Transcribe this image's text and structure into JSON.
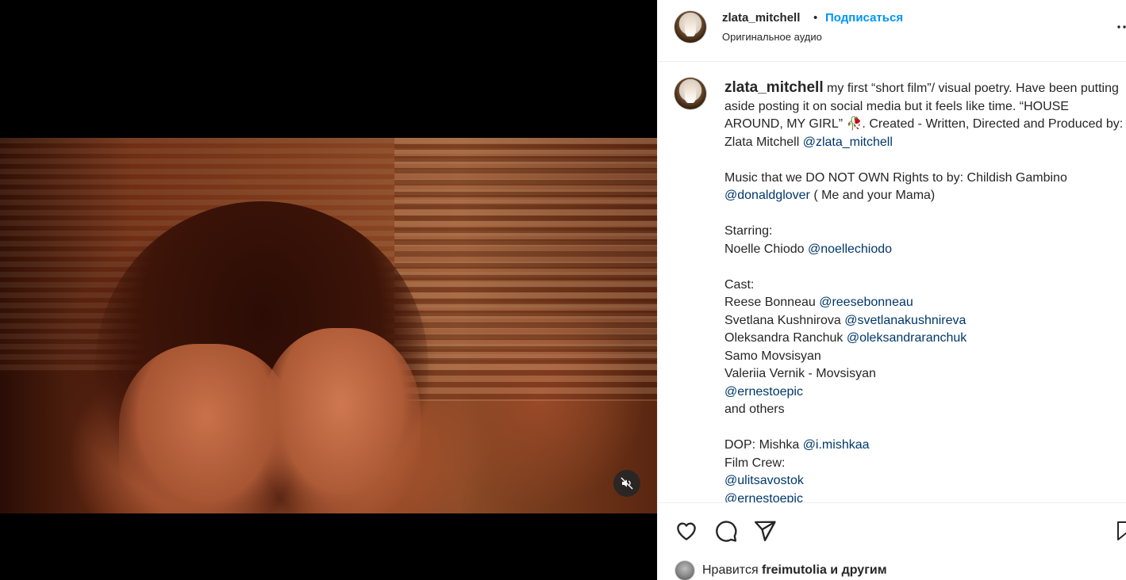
{
  "post": {
    "username": "zlata_mitchell",
    "separator": "•",
    "follow_label": "Подписаться",
    "audio_label": "Оригинальное аудио"
  },
  "caption": {
    "username": "zlata_mitchell",
    "line1": " my first “short film”/ visual poetry. Have been putting aside posting it on social media but it feels like time. “HOUSE AROUND, MY GIRL” 🥀. Created - Written, Directed and Produced by: Zlata Mitchell ",
    "mention_author": "@zlata_mitchell",
    "music_text": "Music that we DO NOT OWN Rights to by: Childish Gambino ",
    "mention_music": "@donaldglover",
    "music_suffix": " ( Me and your Mama)",
    "starring_label": "Starring:",
    "star_name": "Noelle Chiodo ",
    "mention_star": "@noellechiodo",
    "cast_label": "Cast:",
    "cast": [
      {
        "name": "Reese Bonneau ",
        "mention": "@reesebonneau"
      },
      {
        "name": "Svetlana Kushnirova ",
        "mention": "@svetlanakushnireva"
      },
      {
        "name": "Oleksandra Ranchuk ",
        "mention": "@oleksandraranchuk"
      },
      {
        "name": "Samo Movsisyan",
        "mention": ""
      },
      {
        "name": "Valeriia Vernik - Movsisyan",
        "mention": ""
      }
    ],
    "mention_ernesto": "@ernestoepic",
    "and_others": "and others",
    "dop_text": "DOP: Mishka ",
    "mention_dop": "@i.mishkaa",
    "film_crew_label": "Film Crew:",
    "mention_crew1": "@ulitsavostok",
    "mention_crew2": "@ernestoepic"
  },
  "likes": {
    "prefix": "Нравится ",
    "user": "freimutolia",
    "suffix": " и другим"
  },
  "icons": {
    "like": "heart-icon",
    "comment": "comment-icon",
    "share": "paper-plane-icon",
    "save": "bookmark-icon",
    "mute": "speaker-muted-icon",
    "more": "more-dots-icon"
  }
}
